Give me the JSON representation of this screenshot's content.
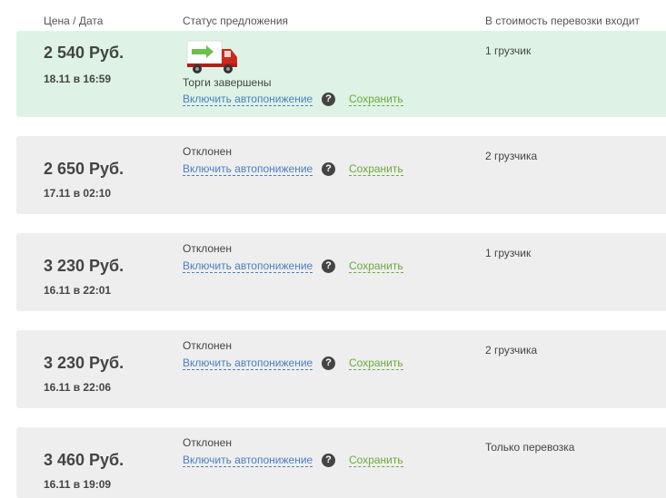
{
  "headers": {
    "price_date": "Цена / Дата",
    "status": "Статус предложения",
    "includes": "В стоимость перевозки входит"
  },
  "actions": {
    "autodecrease_label": "Включить автопонижение",
    "help_symbol": "?",
    "save_label": "Сохранить"
  },
  "colors": {
    "accepted_row_bg": "#def3e5",
    "row_bg": "#eeeeee",
    "link_blue": "#4a7fc1",
    "link_green": "#6aaa3a"
  },
  "offers": [
    {
      "price": "2 540 Руб.",
      "date": "18.11 в 16:59",
      "status": "Торги завершены",
      "status_icon": "red-truck-icon",
      "includes": "1 грузчик",
      "accepted": true
    },
    {
      "price": "2 650 Руб.",
      "date": "17.11 в 02:10",
      "status": "Отклонен",
      "includes": "2 грузчика",
      "accepted": false
    },
    {
      "price": "3 230 Руб.",
      "date": "16.11 в 22:01",
      "status": "Отклонен",
      "includes": "1 грузчик",
      "accepted": false
    },
    {
      "price": "3 230 Руб.",
      "date": "16.11 в 22:06",
      "status": "Отклонен",
      "includes": "2 грузчика",
      "accepted": false
    },
    {
      "price": "3 460 Руб.",
      "date": "16.11 в 19:09",
      "status": "Отклонен",
      "includes": "Только перевозка",
      "accepted": false
    }
  ]
}
